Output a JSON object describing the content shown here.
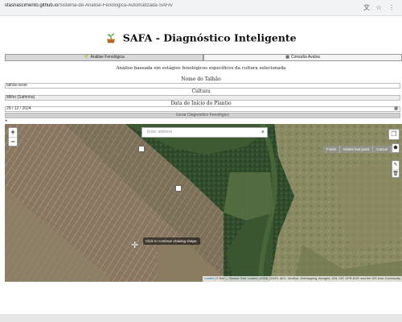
{
  "browser": {
    "url_domain": "sfasnascimento.github.io",
    "url_path": "/Sistema-de-Analise-Fenologica-Automatizada-SAFA/"
  },
  "header": {
    "title": "SAFA - Diagnóstico Inteligente",
    "icon": "sprout-icon"
  },
  "tabs": [
    {
      "label": "Análise Fenológica",
      "icon": "sprout-icon",
      "active": true
    },
    {
      "label": "Consulta Avulsa",
      "icon": "calendar-icon",
      "active": false
    }
  ],
  "description": "Análise baseada em estágios fenológicos específicos da cultura selecionada",
  "form": {
    "field_name_label": "Nome do Talhão",
    "field_name_value": "talhão teste",
    "culture_label": "Cultura",
    "culture_value": "Milho (Safrinha)",
    "date_label": "Data de Início do Plantio",
    "date_value": "29 / 12 / 2024",
    "generate_label": "Gerar Diagnóstico Fenológico"
  },
  "map": {
    "search_placeholder": "Enter address",
    "draw_actions": [
      "Finish",
      "Delete last point",
      "Cancel"
    ],
    "tooltip": "Click to continue drawing shape.",
    "attribution_leaflet": "Leaflet",
    "attribution_text": " | © Esri — Source: Esri, i-cubed, USDA, USGS, AEX, GeoEye, Getmapping, Aerogrid, IGN, IGP, UPR-EGP, and the GIS User Community"
  },
  "colors": {
    "farmland": "#8c7a64",
    "forest": "#2f4a2b",
    "pasture": "#8b9062"
  }
}
